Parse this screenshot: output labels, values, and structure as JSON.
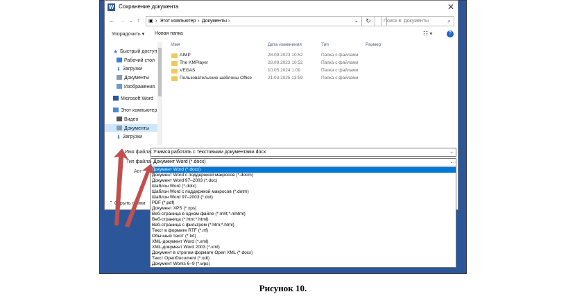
{
  "window": {
    "title": "Сохранение документа",
    "app_icon": "W"
  },
  "nav": {
    "breadcrumb": [
      "Этот компьютер",
      "Документы"
    ],
    "search_placeholder": "Поиск в: Документы"
  },
  "toolbar": {
    "organize": "Упорядочить ▾",
    "new_folder": "Новая папка"
  },
  "sidebar": {
    "items": [
      {
        "label": "Быстрый доступ",
        "icon": "star-icon"
      },
      {
        "label": "Рабочий стол",
        "icon": "desktop-icon"
      },
      {
        "label": "Загрузки",
        "icon": "download-icon"
      },
      {
        "label": "Документы",
        "icon": "documents-icon"
      },
      {
        "label": "Изображения",
        "icon": "pictures-icon"
      },
      {
        "label": "Microsoft Word",
        "icon": "word-icon"
      },
      {
        "label": "Этот компьютер",
        "icon": "computer-icon"
      },
      {
        "label": "Видео",
        "icon": "video-icon"
      },
      {
        "label": "Документы",
        "icon": "documents-icon"
      },
      {
        "label": "Загрузки",
        "icon": "download-icon"
      }
    ],
    "hide_folders": "Скрыть папки"
  },
  "file_list": {
    "columns": [
      "Имя",
      "Дата изменения",
      "Тип",
      "Размер"
    ],
    "rows": [
      {
        "name": "AIMP",
        "date": "28.09.2023 10:52",
        "type": "Папка с файлами"
      },
      {
        "name": "The KMPlayer",
        "date": "28.09.2023 10:52",
        "type": "Папка с файлами"
      },
      {
        "name": "VEGAS",
        "date": "10.05.2024 1:09",
        "type": "Папка с файлами"
      },
      {
        "name": "Пользовательские шаблоны Office",
        "date": "21.03.2025 13:59",
        "type": "Папка с файлами"
      }
    ]
  },
  "form": {
    "filename_label": "Имя файла:",
    "filename_value": "Учимся работать с текстовыми документами.docx",
    "filetype_label": "Тип файла:",
    "filetype_value": "Документ Word (*.docx)",
    "author_label": "Авт"
  },
  "filetype_options": [
    "Документ Word (*.docx)",
    "Документ Word с поддержкой макросов (*.docm)",
    "Документ Word 97–2003 (*.doc)",
    "Шаблон Word (*.dotx)",
    "Шаблон Word с поддержкой макросов (*.dotm)",
    "Шаблон Word 97–2003 (*.dot)",
    "PDF (*.pdf)",
    "Документ XPS (*.xps)",
    "Веб-страница в одном файле (*.mht;*.mhtml)",
    "Веб-страница (*.htm;*.html)",
    "Веб-страница с фильтром (*.htm;*.html)",
    "Текст в формате RTF (*.rtf)",
    "Обычный текст (*.txt)",
    "XML-документ Word (*.xml)",
    "XML-документ Word 2003 (*.xml)",
    "Документ в строгом формате Open XML (*.docx)",
    "Текст OpenDocument (*.odt)",
    "Документ Works 6–9 (*.wps)"
  ],
  "side_text": "Ал",
  "caption": "Рисунок 10.",
  "colors": {
    "accent": "#2b579a",
    "selection": "#0078d7",
    "arrow": "#c0504d"
  }
}
